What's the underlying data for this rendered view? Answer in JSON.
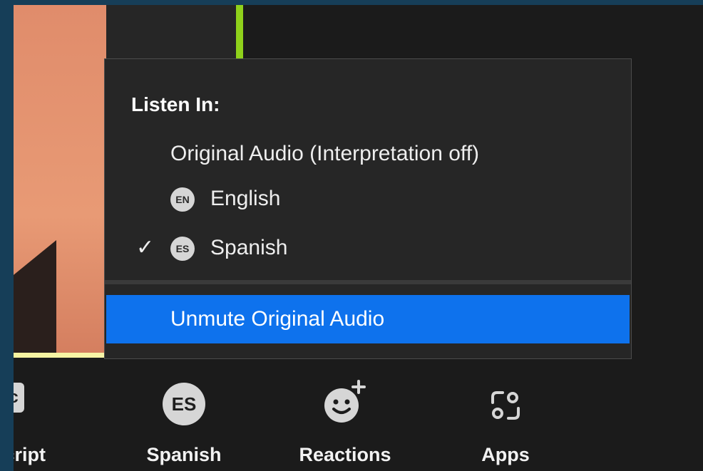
{
  "menu": {
    "heading": "Listen In:",
    "items": [
      {
        "label": "Original Audio (Interpretation off)",
        "badge": "",
        "checked": false
      },
      {
        "label": "English",
        "badge": "EN",
        "checked": false
      },
      {
        "label": "Spanish",
        "badge": "ES",
        "checked": true
      }
    ],
    "check_glyph": "✓",
    "action_label": "Unmute Original Audio"
  },
  "toolbar": {
    "items": [
      {
        "label": "nscript",
        "icon": "cc-icon",
        "icon_text": "c"
      },
      {
        "label": "Spanish",
        "icon": "language-es-icon",
        "icon_text": "ES"
      },
      {
        "label": "Reactions",
        "icon": "reactions-icon"
      },
      {
        "label": "Apps",
        "icon": "apps-icon"
      }
    ]
  },
  "colors": {
    "accent": "#0e72ed",
    "menu_bg": "#262626",
    "app_bg": "#1b1b1b",
    "speaker_green": "#8fd11b",
    "speaker_yellow": "#f6f3a0"
  }
}
